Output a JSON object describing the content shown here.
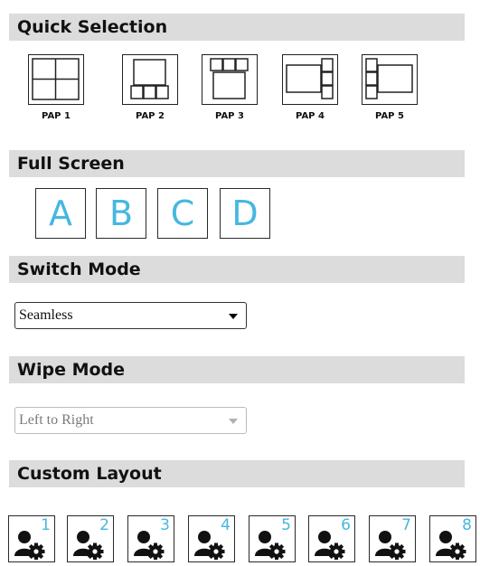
{
  "sections": {
    "quick_selection": "Quick Selection",
    "full_screen": "Full Screen",
    "switch_mode": "Switch Mode",
    "wipe_mode": "Wipe Mode",
    "custom_layout": "Custom Layout"
  },
  "pap_labels": [
    "PAP 1",
    "PAP 2",
    "PAP 3",
    "PAP 4",
    "PAP 5"
  ],
  "full_screen_buttons": [
    "A",
    "B",
    "C",
    "D"
  ],
  "switch_mode_value": "Seamless",
  "wipe_mode_value": "Left to Right",
  "custom_layout_numbers": [
    "1",
    "2",
    "3",
    "4",
    "5",
    "6",
    "7",
    "8"
  ],
  "colors": {
    "accent": "#45b8e0",
    "header_bg": "#dcdcdc"
  },
  "icons": {
    "custom_layout": "user-settings-icon",
    "dropdown": "chevron-down-icon"
  }
}
